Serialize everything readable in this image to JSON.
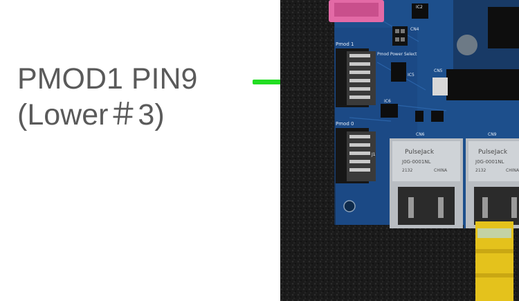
{
  "callout": {
    "line1": "PMOD1 PIN9",
    "line2": "(Lower＃3)",
    "text_color": "#5a5a5a",
    "line_color": "#22dd22"
  },
  "board": {
    "pmod1_label": "Pmod 1",
    "pmod0_label": "Pmod 0",
    "power_select_label": "Pmod Power Select",
    "cn4_label": "CN4",
    "cn5_label": "CN5",
    "cn6_label": "CN6",
    "cn9_label": "CN9",
    "ic2_label": "IC2",
    "ic5_label": "IC5",
    "ic6_label": "IC6",
    "j1_label": "J1",
    "jack_brand": "PulseJack",
    "jack_part": "J0G-0001NL",
    "jack_code": "2132",
    "jack_origin": "CHINA"
  },
  "colors": {
    "pcb_blue": "#1d4f8c",
    "pcb_dark": "#163d6e",
    "foam_black": "#1b1b1b",
    "connector_pink": "#e36aa6",
    "cable_yellow": "#e4c21c"
  }
}
